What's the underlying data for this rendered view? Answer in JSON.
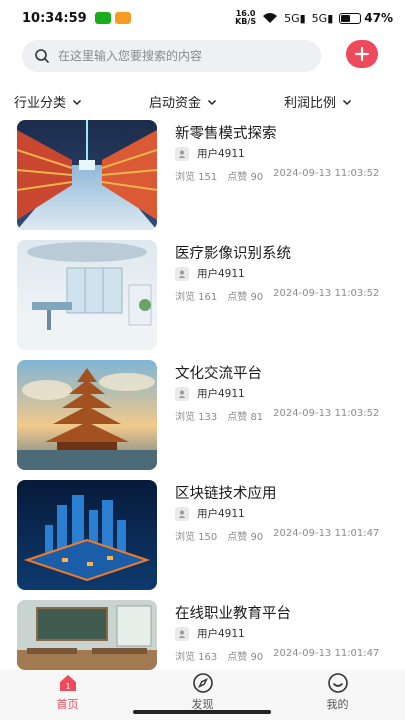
{
  "status_bar": {
    "time": "10:34:59",
    "speed_value": "16.0",
    "speed_unit": "KB/S",
    "signal1": "5G",
    "signal2": "5G",
    "battery_percent": "47%",
    "battery_level": 0.47
  },
  "search": {
    "placeholder": "在这里输入您要搜索的内容",
    "value": ""
  },
  "filters": [
    {
      "label": "行业分类"
    },
    {
      "label": "启动资金"
    },
    {
      "label": "利润比例"
    }
  ],
  "posts": [
    {
      "title": "新零售模式探索",
      "author": "用户4911",
      "views": "浏览 151",
      "likes": "点赞 90",
      "time": "2024-09-13 11:03:52",
      "image": "retail-store-image"
    },
    {
      "title": "医疗影像识别系统",
      "author": "用户4911",
      "views": "浏览 161",
      "likes": "点赞 90",
      "time": "2024-09-13 11:03:52",
      "image": "medical-room-image"
    },
    {
      "title": "文化交流平台",
      "author": "用户4911",
      "views": "浏览 133",
      "likes": "点赞 81",
      "time": "2024-09-13 11:03:52",
      "image": "pagoda-image"
    },
    {
      "title": "区块链技术应用",
      "author": "用户4911",
      "views": "浏览 150",
      "likes": "点赞 90",
      "time": "2024-09-13 11:01:47",
      "image": "blockchain-city-image"
    },
    {
      "title": "在线职业教育平台",
      "author": "用户4911",
      "views": "浏览 163",
      "likes": "点赞 90",
      "time": "2024-09-13 11:01:47",
      "image": "classroom-image"
    }
  ],
  "tabbar": {
    "home": "首页",
    "discover": "发现",
    "mine": "我的",
    "active": "home"
  },
  "colors": {
    "accent": "#ef4a5c",
    "active_tab": "#e64a5c"
  }
}
